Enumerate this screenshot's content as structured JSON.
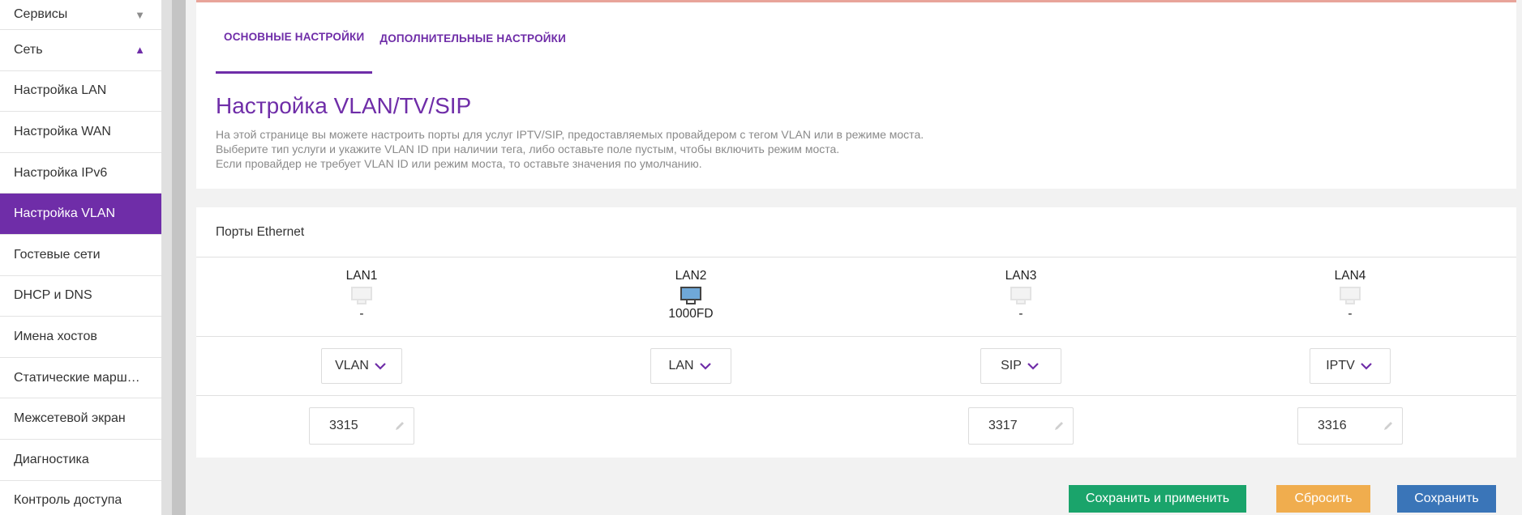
{
  "sidebar": {
    "items": [
      {
        "label": "Сервисы",
        "arrow": "▼"
      },
      {
        "label": "Сеть",
        "arrow": "▲"
      },
      {
        "label": "Настройка LAN"
      },
      {
        "label": "Настройка WAN"
      },
      {
        "label": "Настройка IPv6"
      },
      {
        "label": "Настройка VLAN",
        "active": true
      },
      {
        "label": "Гостевые сети"
      },
      {
        "label": "DHCP и DNS"
      },
      {
        "label": "Имена хостов"
      },
      {
        "label": "Статические маршрутизация"
      },
      {
        "label": "Межсетевой экран"
      },
      {
        "label": "Диагностика"
      },
      {
        "label": "Контроль доступа"
      }
    ]
  },
  "tabs": {
    "basic": "ОСНОВНЫЕ НАСТРОЙКИ",
    "advanced": "ДОПОЛНИТЕЛЬНЫЕ НАСТРОЙКИ"
  },
  "page": {
    "title": "Настройка VLAN/TV/SIP",
    "desc1": "На этой странице вы можете настроить порты для услуг IPTV/SIP, предоставляемых провайдером с тегом VLAN или в режиме моста.",
    "desc2": "Выберите тип услуги и укажите VLAN ID при наличии тега, либо оставьте поле пустым, чтобы включить режим моста.",
    "desc3": "Если провайдер не требует VLAN ID или режим моста, то оставьте значения по умолчанию."
  },
  "ports": {
    "title": "Порты Ethernet",
    "list": [
      {
        "name": "LAN1",
        "speed": "-",
        "type": "VLAN",
        "vlan": "3315"
      },
      {
        "name": "LAN2",
        "speed": "1000FD",
        "type": "LAN",
        "vlan": ""
      },
      {
        "name": "LAN3",
        "speed": "-",
        "type": "SIP",
        "vlan": "3317"
      },
      {
        "name": "LAN4",
        "speed": "-",
        "type": "IPTV",
        "vlan": "3316"
      }
    ]
  },
  "buttons": {
    "save_apply": "Сохранить и применить",
    "reset": "Сбросить",
    "save": "Сохранить"
  },
  "colors": {
    "accent": "#6f2da8",
    "green": "#1aa46b",
    "orange": "#f0ad4e",
    "blue": "#3a75b8"
  },
  "icons": {
    "port_active": "ethernet-port-active-icon",
    "port_inactive": "ethernet-port-inactive-icon",
    "select": "chevron-down-icon",
    "edit": "pencil-icon"
  }
}
